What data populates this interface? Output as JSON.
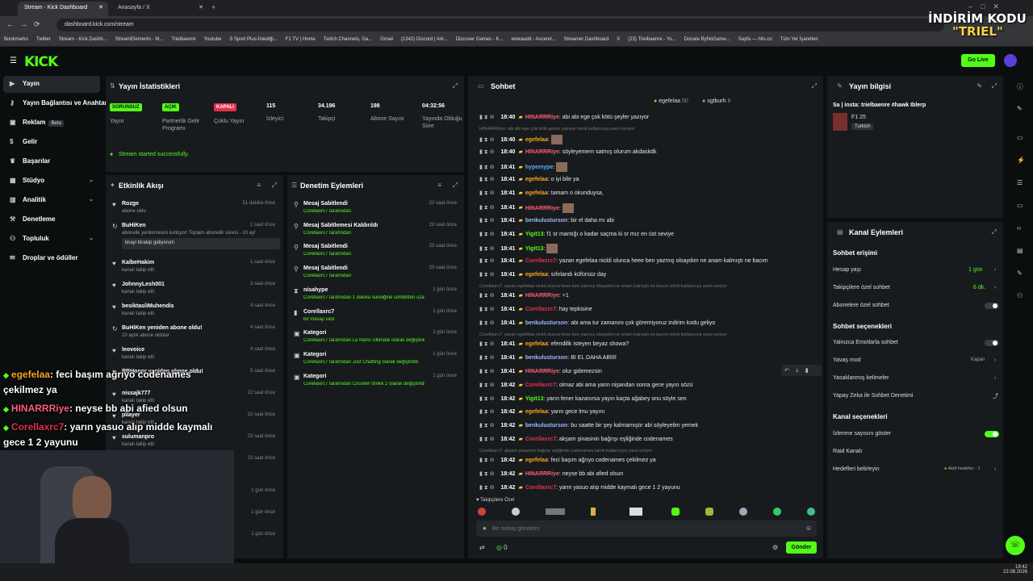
{
  "browser": {
    "tabs": [
      {
        "label": "Stream - Kick Dashboard"
      },
      {
        "label": "Anasayfa / X"
      }
    ],
    "url": "dashboard.kick.com/stream",
    "bookmarks": [
      "Bookmarks",
      "Twitter",
      "Stream - Kick Dashb...",
      "StreamElements - M...",
      "Trielbaenre",
      "Youtube",
      "S Sport Plus-İstediği...",
      "F1 TV | Home",
      "Twitch Channels, Ga...",
      "Gmail",
      "(1342) Discord | Ark...",
      "Discover Games - K...",
      "wowaudit - Ascend...",
      "Streamer Dashboard",
      "X",
      "(23) Trielbaenre - Yo...",
      "Donate ByNoGame...",
      "Sayfa — hits.co",
      "Tüm Yer İşaretleri"
    ]
  },
  "header": {
    "logo": "KICK",
    "go_live": "Go Live"
  },
  "sidebar": {
    "items": [
      {
        "label": "Yayın",
        "icon": "video-icon"
      },
      {
        "label": "Yayın Bağlantısı ve Anahtarı",
        "icon": "key-icon"
      },
      {
        "label": "Reklam",
        "icon": "ad-icon",
        "badge": "Beta"
      },
      {
        "label": "Gelir",
        "icon": "dollar-icon"
      },
      {
        "label": "Başarılar",
        "icon": "trophy-icon"
      },
      {
        "label": "Stüdyo",
        "icon": "studio-icon"
      },
      {
        "label": "Analitik",
        "icon": "chart-icon"
      },
      {
        "label": "Denetleme",
        "icon": "hammer-icon"
      },
      {
        "label": "Topluluk",
        "icon": "people-icon"
      },
      {
        "label": "Droplar ve ödüller",
        "icon": "gift-icon"
      }
    ]
  },
  "stats": {
    "title": "Yayın İstatistikleri",
    "cols": [
      {
        "badge": "SORUNSUZ",
        "label": "Yayın",
        "color": "#53fc18"
      },
      {
        "badge": "AÇIK",
        "label": "Partnerlik Gelir Programı",
        "color": "#53fc18"
      },
      {
        "badge": "KAPALI",
        "label": "Çoklu Yayın",
        "color": "#e2304d"
      },
      {
        "value": "115",
        "label": "İzleyici"
      },
      {
        "value": "34.196",
        "label": "Takipçi"
      },
      {
        "value": "198",
        "label": "Abone Sayısı"
      },
      {
        "value": "04:32:56",
        "label": "Yayında Olduğu Süre"
      }
    ],
    "success": "Stream started successfully."
  },
  "activity": {
    "title": "Etkinlik Akışı",
    "rows": [
      {
        "t": "Rozge",
        "s": "abone oldu",
        "time": "51 dakika önce"
      },
      {
        "t": "BuHiKen",
        "s": "abonelik yenilemesini kutluyor! Toplam abonelik süresi - 10 ay!",
        "s2": "kirayi birakip gidiyorum",
        "time": "1 saat önce"
      },
      {
        "t": "KalbeHakim",
        "s": "kanalı takip etti",
        "time": "1 saat önce"
      },
      {
        "t": "JohnnyLesh001",
        "s": "kanalı takip etti",
        "time": "3 saat önce"
      },
      {
        "t": "besiktasliMuhendis",
        "s": "kanalı takip etti",
        "time": "4 saat önce"
      },
      {
        "t": "BuHiKen yeniden abone oldu!",
        "s": "10 aylık abone oldular",
        "time": "4 saat önce"
      },
      {
        "t": "leovoice",
        "s": "kanalı takip etti",
        "time": "4 saat önce"
      },
      {
        "t": "RBHonor yeniden abone oldu!",
        "s": "",
        "time": "5 saat önce"
      },
      {
        "t": "nissajk777",
        "s": "kanalı takip etti",
        "time": "22 saat önce"
      },
      {
        "t": "pllayer",
        "s": "kanalı takip etti",
        "time": "22 saat önce"
      },
      {
        "t": "sulumanpro",
        "s": "kanalı takip etti",
        "time": "23 saat önce"
      },
      {
        "t": "",
        "s": "süresi - 9 ay!",
        "time": "23 saat önce"
      },
      {
        "t": "",
        "s": "",
        "time": "1 gün önce"
      },
      {
        "t": "",
        "s": "",
        "time": "1 gün önce"
      },
      {
        "t": "",
        "s": "",
        "time": "1 gün önce"
      }
    ]
  },
  "moderation": {
    "title": "Denetim Eylemleri",
    "rows": [
      {
        "t": "Mesaj Sabitlendi",
        "s": "Corellaxrc7 tarafından",
        "time": "22 saat önce"
      },
      {
        "t": "Mesaj Sabitlemesi Kaldırıldı",
        "s": "Corellaxrc7 tarafından",
        "time": "23 saat önce"
      },
      {
        "t": "Mesaj Sabitlendi",
        "s": "Corellaxrc7 tarafından",
        "time": "23 saat önce"
      },
      {
        "t": "Mesaj Sabitlendi",
        "s": "Corellaxrc7 tarafından",
        "time": "23 saat önce"
      },
      {
        "t": "nisahype",
        "s": "Corellaxrc7 tarafından 1 dakika süreliğine sohbetten uzaklaştırıldı",
        "time": "1 gün önce"
      },
      {
        "t": "Corellaxrc7",
        "s": "bir mesajı sildi",
        "time": "1 gün önce"
      },
      {
        "t": "Kategori",
        "s": "Corellaxrc7 tarafından Le Mans Ultimate olarak değiştirildi",
        "time": "1 gün önce"
      },
      {
        "t": "Kategori",
        "s": "Corellaxrc7 tarafından Just Chatting olarak değiştirildi",
        "time": "1 gün önce"
      },
      {
        "t": "Kategori",
        "s": "Corellaxrc7 tarafından Counter-Strike 2 olarak değiştirildi",
        "time": "1 gün önce"
      }
    ]
  },
  "chat": {
    "title": "Sohbet",
    "top_users": [
      {
        "name": "egefelaa",
        "count": "50"
      },
      {
        "name": "sgtburh",
        "count": "8"
      }
    ],
    "lines": [
      {
        "time": "18:40",
        "user": "HINARRRiye",
        "color": "#ff5c7a",
        "msg": "abi abi ege çok kötü şeyler yazıyor"
      },
      {
        "hint": "HINARRRiye: abi abi ege çok kötü şeyler yazıyor isimli kullanıcıya yanıt veriyor"
      },
      {
        "time": "18:40",
        "user": "egefelaa",
        "color": "#f5a623",
        "msg": ""
      },
      {
        "time": "18:40",
        "user": "HINARRRiye",
        "color": "#ff5c7a",
        "msg": "söyleyemem satmış olurum akdaskdk"
      },
      {
        "time": "18:41",
        "user": "hypemype",
        "color": "#5da8ff",
        "msg": ""
      },
      {
        "time": "18:41",
        "user": "egefelaa",
        "color": "#f5a623",
        "msg": "o iyi bile ya"
      },
      {
        "time": "18:41",
        "user": "egefelaa",
        "color": "#f5a623",
        "msg": "tamam o okunduysa,"
      },
      {
        "time": "18:41",
        "user": "HINARRRiye",
        "color": "#ff5c7a",
        "msg": ""
      },
      {
        "time": "18:41",
        "user": "benkulusturson",
        "color": "#9cb6ff",
        "msg": "bir el daha mı abi"
      },
      {
        "time": "18:41",
        "user": "Yigit13",
        "color": "#53fc18",
        "msg": "f1 sr mantığı o kadar saçma ki sr mız en üst seviye"
      },
      {
        "time": "18:41",
        "user": "Yigit13",
        "color": "#53fc18",
        "msg": ""
      },
      {
        "time": "18:41",
        "user": "Corellaxrc7",
        "color": "#e2304d",
        "msg": "yazan egefelaa nickli olunca heee ben yazmış olsaydım ne anam kalmıştı ne bacım"
      },
      {
        "time": "18:41",
        "user": "egefelaa",
        "color": "#f5a623",
        "msg": "sıfırlandı küfürsüz day"
      },
      {
        "hint": "Corellaxrc7: yazan egefelaa nickli olunca heee ben yazmış olsaydım ne anam kalmıştı ne bacım isimli kullanıcıya yanıt veriyor"
      },
      {
        "time": "18:41",
        "user": "HINARRRiye",
        "color": "#ff5c7a",
        "msg": "+1"
      },
      {
        "time": "18:41",
        "user": "Corellaxrc7",
        "color": "#e2304d",
        "msg": "hay tepkisine"
      },
      {
        "time": "18:41",
        "user": "benkulusturson",
        "color": "#9cb6ff",
        "msg": "abi ama tur zamanını çok göremiyoruz indirim kodu geliyo"
      },
      {
        "hint": "Corellaxrc7: yazan egefelaa nickli olunca heee ben yazmış olsaydım ne anam kalmıştı ne bacım isimli kullanıcıya yanıt veriyor"
      },
      {
        "time": "18:41",
        "user": "egefelaa",
        "color": "#f5a623",
        "msg": "efendilik isteyen beyaz showa?"
      },
      {
        "time": "18:41",
        "user": "benkulusturson",
        "color": "#9cb6ff",
        "msg": "BI EL DAHA ABİİİİ"
      },
      {
        "time": "18:41",
        "user": "HINARRRiye",
        "color": "#ff5c7a",
        "msg": "olur gidemezsin"
      },
      {
        "time": "18:42",
        "user": "Corellaxrc7",
        "color": "#e2304d",
        "msg": "olmaz abi ama yarın nişandan sonra gece yayın sözü"
      },
      {
        "time": "18:42",
        "user": "Yigit13",
        "color": "#53fc18",
        "msg": "yarın fener kazanırsa yayın kaçta ağabey onu söyle sen"
      },
      {
        "time": "18:42",
        "user": "egefelaa",
        "color": "#f5a623",
        "msg": "yarın gece lmu yayını"
      },
      {
        "time": "18:42",
        "user": "benkulusturson",
        "color": "#9cb6ff",
        "msg": "bu saatte bir şey kalmamıştır abi söyleyelim yemek"
      },
      {
        "time": "18:42",
        "user": "Corellaxrc7",
        "color": "#e2304d",
        "msg": "akşam şinasinin bağrışı eşliğinde codenames"
      },
      {
        "hint": "Corellaxrc7: akşam şinasinin bağrışı eşliğinde codenames isimli kullanıcıya yanıt veriyor"
      },
      {
        "time": "18:42",
        "user": "egefelaa",
        "color": "#f5a623",
        "msg": "feci başım ağrıyo codenames çekilmez ya"
      },
      {
        "time": "18:42",
        "user": "HINARRRiye",
        "color": "#ff5c7a",
        "msg": "neyse bb abi afied olsun"
      },
      {
        "time": "18:42",
        "user": "Corellaxrc7",
        "color": "#e2304d",
        "msg": "yarın yasuo alıp midde kaymalı gece 1 2 yayunu"
      }
    ],
    "followers_only": "Takipçilere Özel",
    "placeholder": "Bir mesaj gönderin",
    "send": "Gönder",
    "points": "0"
  },
  "stream_info": {
    "title": "Yayın bilgisi",
    "stream_title": "Sa | insta: trielbaenre #hawk Iblerp",
    "category": "F1 25",
    "language": "Turkish"
  },
  "channel_actions": {
    "title": "Kanal Eylemleri",
    "chat_access": "Sohbet erişimi",
    "account_age": {
      "label": "Hesap yaşı",
      "value": "1 gün"
    },
    "followers_chat": {
      "label": "Takipçilere özel sohbet",
      "value": "6 dk."
    },
    "subs_chat": "Abonelere özel sohbet",
    "chat_options": "Sohbet seçenekleri",
    "emotes_only": "Yalnızca Emotlarla sohbet",
    "slow_mode": {
      "label": "Yavaş mod",
      "value": "Kapalı"
    },
    "banned_words": "Yasaklanmış kelimeler",
    "ai_mod": "Yapay Zeka ile Sohbet Denetimi",
    "channel_options": "Kanal seçenekleri",
    "show_viewers": "İzlenme sayısını göster",
    "raid": "Raid Kanalı",
    "goals": {
      "label": "Hedefleri belirleyin",
      "value": "Aktif hedefler - 1"
    }
  },
  "overlay": {
    "brand_line1": "İNDİRİM KODU",
    "brand_line2": "\"TRIEL\"",
    "lines": [
      {
        "user": "egefelaa",
        "color": "#f5a623",
        "msg": ": feci başım ağrıyo codenames"
      },
      {
        "user": "",
        "color": "#ffffff",
        "msg": "çekilmez ya"
      },
      {
        "user": "HINARRRiye",
        "color": "#ff5c7a",
        "msg": ": neyse bb abi afied olsun"
      },
      {
        "user": "Corellaxrc7",
        "color": "#e2304d",
        "msg": ": yarın yasuo alıp midde kaymalı"
      },
      {
        "user": "",
        "color": "#ffffff",
        "msg": "gece 1 2 yayunu"
      }
    ]
  },
  "taskbar": {
    "time": "19:42",
    "date": "22.08.2026"
  }
}
